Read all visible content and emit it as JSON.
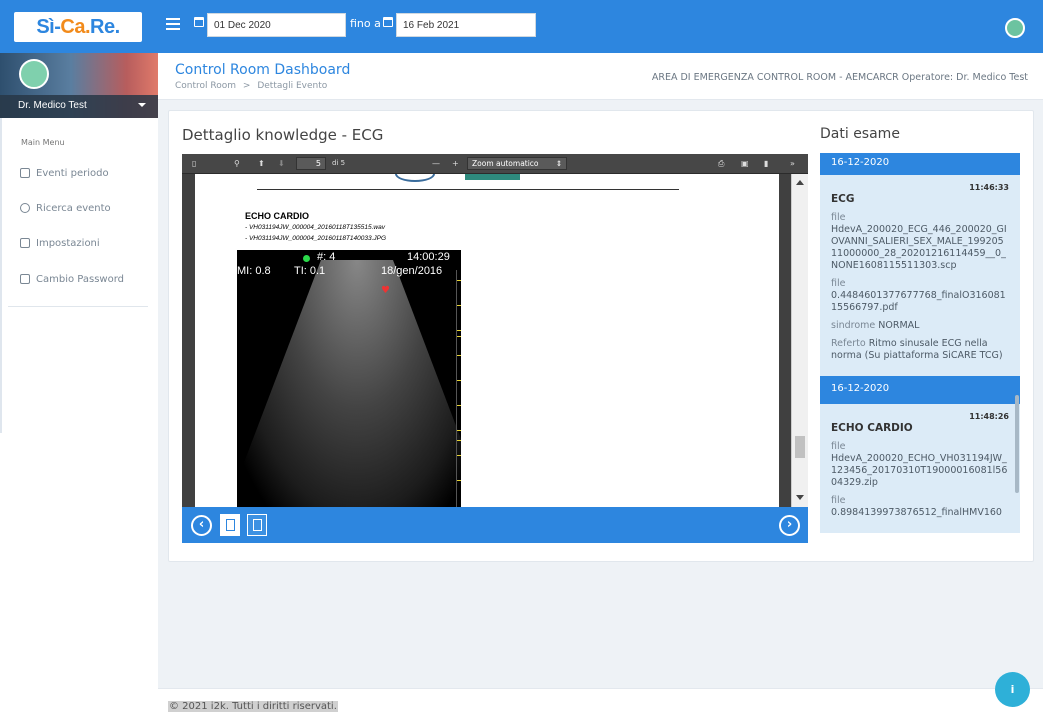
{
  "logo": {
    "part1": "Sì-",
    "part2": "Ca.",
    "part3": "Re."
  },
  "filter": {
    "from_value": "01 Dec 2020",
    "to_label": "fino a",
    "to_value": "16 Feb 2021"
  },
  "user": {
    "name": "Dr. Medico Test"
  },
  "menu": {
    "title": "Main Menu",
    "items": [
      {
        "label": "Eventi periodo",
        "icon": "calendar-icon"
      },
      {
        "label": "Ricerca evento",
        "icon": "search-icon"
      },
      {
        "label": "Impostazioni",
        "icon": "settings-icon"
      },
      {
        "label": "Cambio Password",
        "icon": "document-icon"
      }
    ]
  },
  "header": {
    "title": "Control Room Dashboard",
    "breadcrumb_home": "Control Room",
    "breadcrumb_sep": ">",
    "breadcrumb_current": "Dettagli Evento",
    "area": "AREA DI EMERGENZA CONTROL ROOM - AEMCARCR Operatore: Dr. Medico Test"
  },
  "detail": {
    "title": "Dettaglio knowledge - ECG",
    "pdf": {
      "page_number": "5",
      "page_of": "di 5",
      "zoom": "Zoom automatico",
      "echo_title": "ECHO CARDIO",
      "files": [
        "- VH031194JW_000004_20160118T135515.wav",
        "- VH031194JW_000004_20160118T140033.JPG"
      ],
      "us_frame": "#: 4",
      "us_time": "14:00:29",
      "us_mi": "MI: 0.8",
      "us_ti": "TI: 0.1",
      "us_date": "18/gen/2016"
    }
  },
  "dati": {
    "title": "Dati esame",
    "entries": [
      {
        "date": "16-12-2020",
        "time": "11:46:33",
        "name": "ECG",
        "file1_label": "file",
        "file1": "HdevA_200020_ECG_446_200020_GIOVANNI_SALIERI_SEX_MALE_19920511000000_28_20201216114459__0_NONE1608115511303.scp",
        "file2_label": "file",
        "file2": "0.4484601377677768_finalO31608115566797.pdf",
        "sindrome_label": "sindrome",
        "sindrome": "NORMAL",
        "referto_label": "Referto",
        "referto": "Ritmo sinusale ECG nella norma (Su piattaforma SiCARE TCG)"
      },
      {
        "date": "16-12-2020",
        "time": "11:48:26",
        "name": "ECHO CARDIO",
        "file1_label": "file",
        "file1": "HdevA_200020_ECHO_VH031194JW_123456_20170310T19000016081l5604329.zip",
        "file2_label": "file",
        "file2": "0.8984139973876512_finalHMV160"
      }
    ]
  },
  "footer": {
    "text": "© 2021 i2k. Tutti i diritti riservati."
  },
  "help": {
    "label": "i"
  },
  "colors": {
    "primary": "#2d86df",
    "accent": "#f28b1b",
    "card": "#dcebf7"
  }
}
